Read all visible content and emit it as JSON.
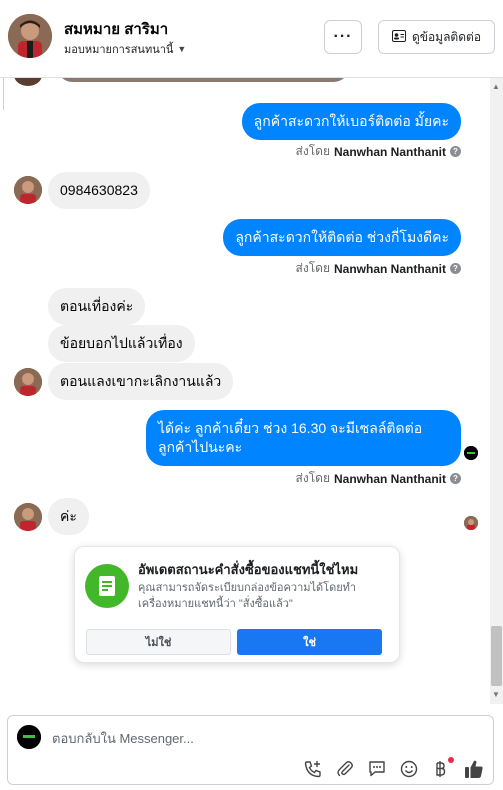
{
  "header": {
    "contact_name": "สมหมาย สาริมา",
    "assignment": "มอบหมายการสนทนานี้",
    "more_label": "···",
    "view_info_label": "ดูข้อมูลติดต่อ"
  },
  "messages": [
    {
      "dir": "out",
      "text": "ลูกค้าสะดวกให้เบอร์ติดต่อ มั้ยคะ",
      "sent_prefix": "ส่งโดย",
      "sent_by": "Nanwhan Nanthanit"
    },
    {
      "dir": "in",
      "text": "0984630823"
    },
    {
      "dir": "out",
      "text": "ลูกค้าสะดวกให้ติดต่อ ช่วงกี่โมงดีคะ",
      "sent_prefix": "ส่งโดย",
      "sent_by": "Nanwhan Nanthanit"
    },
    {
      "dir": "in",
      "text": "ตอนเที่องค่ะ"
    },
    {
      "dir": "in",
      "text": "ข้อยบอกไปแล้วเทื่อง"
    },
    {
      "dir": "in",
      "text": "ตอนแลงเขากะเลิกงานแล้ว"
    },
    {
      "dir": "out",
      "text": "ได้ค่ะ ลูกค้าเดี๋ยว ช่วง 16.30 จะมีเซลล์ติดต่อ ลูกค้าไปนะคะ",
      "sent_prefix": "ส่งโดย",
      "sent_by": "Nanwhan Nanthanit"
    },
    {
      "dir": "in",
      "text": "ค่ะ"
    }
  ],
  "order_card": {
    "title": "อัพเดตสถานะคำสั่งซื้อของแชทนี้ใช่ไหม",
    "description": "คุณสามารถจัดระเบียบกล่องข้อความได้โดยทำเครื่องหมายแชทนี้ว่า \"สั่งซื้อแล้ว\"",
    "no_label": "ไม่ใช่",
    "yes_label": "ใช่"
  },
  "composer": {
    "placeholder": "ตอบกลับใน Messenger...",
    "tools": [
      "call-add-icon",
      "paperclip-icon",
      "saved-reply-icon",
      "emoji-icon",
      "baht-icon",
      "thumbs-up-icon"
    ]
  },
  "colors": {
    "outgoing_bubble": "#0084ff",
    "incoming_bubble": "#f0f0f0",
    "primary_button": "#1877f2",
    "card_icon": "#42b72a"
  }
}
